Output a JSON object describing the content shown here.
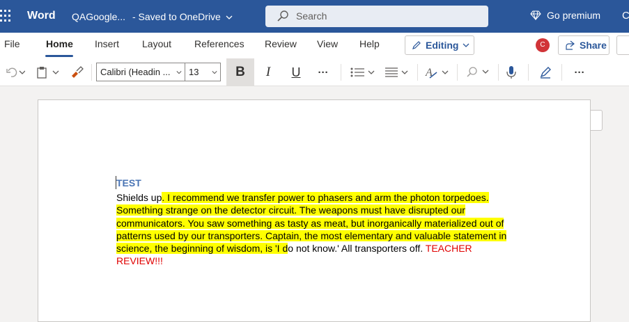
{
  "titlebar": {
    "app_name": "Word",
    "doc_name": "QAGoogle...",
    "saved_status": "- Saved to OneDrive",
    "search_placeholder": "Search",
    "go_premium": "Go premium",
    "cut_label": "C"
  },
  "tabs": [
    "File",
    "Home",
    "Insert",
    "Layout",
    "References",
    "Review",
    "View",
    "Help"
  ],
  "active_tab": "Home",
  "editing_label": "Editing",
  "avatar_letter": "C",
  "share_label": "Share",
  "toolbar": {
    "font_name": "Calibri (Headin ...",
    "font_size": "13",
    "bold": "B",
    "italic": "I",
    "underline": "U",
    "more": "···"
  },
  "document": {
    "heading": "TEST",
    "plain_start": "Shields up",
    "highlighted": ". I recommend we transfer power to phasers and arm the photon torpedoes. Something strange on the detector circuit. The weapons must have disrupted our communicators. You saw something as tasty as meat, but inorganically materialized out of patterns used by our transporters. Captain, the most elementary and valuable statement in science, the beginning of wisdom, is 'I d",
    "plain_end": "o not know.' All transporters off. ",
    "red_text": "TEACHER REVIEW!!!"
  },
  "colors": {
    "titlebar": "#2b579a",
    "heading": "#4a75b5",
    "highlight": "#ffff00",
    "red": "#e00000"
  }
}
